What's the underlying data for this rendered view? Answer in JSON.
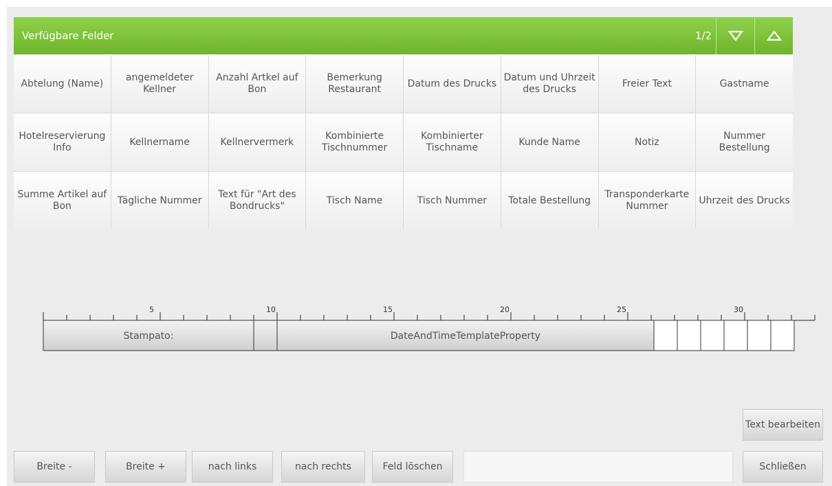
{
  "header": {
    "title": "Verfügbare Felder",
    "page_indicator": "1/2",
    "down_icon": "triangle-down-outline-icon",
    "up_icon": "triangle-up-outline-icon",
    "color": "#7cc23a"
  },
  "fields": [
    "Abtelung (Name)",
    "angemeldeter Kellner",
    "Anzahl Artkel auf Bon",
    "Bemerkung Restaurant",
    "Datum des Drucks",
    "Datum und Uhrzeit des Drucks",
    "Freier Text",
    "Gastname",
    "Hotelreservierung Info",
    "Kellnername",
    "Kellnervermerk",
    "Kombinierte Tischnummer",
    "Kombinierter Tischname",
    "Kunde Name",
    "Notiz",
    "Nummer Bestellung",
    "Summe Artikel auf Bon",
    "Tägliche Nummer",
    "Text für \"Art des Bondrucks\"",
    "Tisch Name",
    "Tisch Nummer",
    "Totale Bestellung",
    "Transponderkarte Nummer",
    "Uhrzeit des Drucks"
  ],
  "ruler": {
    "labels": [
      "5",
      "10",
      "15",
      "20",
      "25",
      "30"
    ],
    "segments": [
      {
        "label": "Stampato:",
        "start": 1,
        "length": 9
      },
      {
        "label": "",
        "start": 10,
        "length": 1
      },
      {
        "label": "DateAndTimeTemplateProperty",
        "start": 11,
        "length": 16
      }
    ],
    "total_columns": 33
  },
  "buttons": {
    "width_minus": "Breite -",
    "width_plus": "Breite +",
    "move_left": "nach links",
    "move_right": "nach rechts",
    "delete_field": "Feld löschen",
    "edit_text": "Text bearbeiten",
    "close": "Schließen"
  }
}
